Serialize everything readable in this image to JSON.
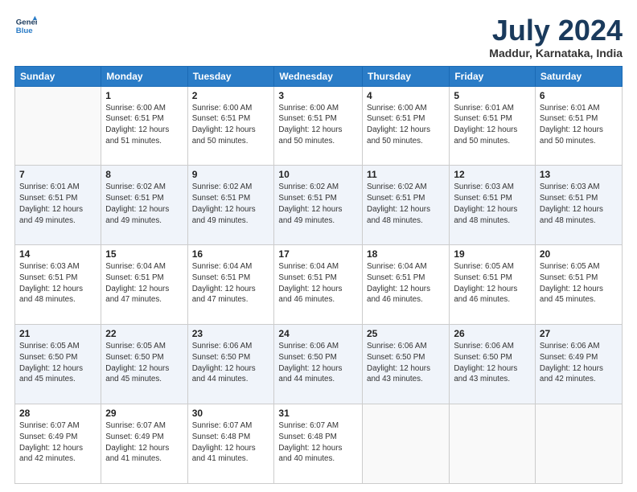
{
  "header": {
    "logo_line1": "General",
    "logo_line2": "Blue",
    "month": "July 2024",
    "location": "Maddur, Karnataka, India"
  },
  "days_of_week": [
    "Sunday",
    "Monday",
    "Tuesday",
    "Wednesday",
    "Thursday",
    "Friday",
    "Saturday"
  ],
  "weeks": [
    [
      {
        "day": "",
        "text": ""
      },
      {
        "day": "1",
        "text": "Sunrise: 6:00 AM\nSunset: 6:51 PM\nDaylight: 12 hours\nand 51 minutes."
      },
      {
        "day": "2",
        "text": "Sunrise: 6:00 AM\nSunset: 6:51 PM\nDaylight: 12 hours\nand 50 minutes."
      },
      {
        "day": "3",
        "text": "Sunrise: 6:00 AM\nSunset: 6:51 PM\nDaylight: 12 hours\nand 50 minutes."
      },
      {
        "day": "4",
        "text": "Sunrise: 6:00 AM\nSunset: 6:51 PM\nDaylight: 12 hours\nand 50 minutes."
      },
      {
        "day": "5",
        "text": "Sunrise: 6:01 AM\nSunset: 6:51 PM\nDaylight: 12 hours\nand 50 minutes."
      },
      {
        "day": "6",
        "text": "Sunrise: 6:01 AM\nSunset: 6:51 PM\nDaylight: 12 hours\nand 50 minutes."
      }
    ],
    [
      {
        "day": "7",
        "text": "Sunrise: 6:01 AM\nSunset: 6:51 PM\nDaylight: 12 hours\nand 49 minutes."
      },
      {
        "day": "8",
        "text": "Sunrise: 6:02 AM\nSunset: 6:51 PM\nDaylight: 12 hours\nand 49 minutes."
      },
      {
        "day": "9",
        "text": "Sunrise: 6:02 AM\nSunset: 6:51 PM\nDaylight: 12 hours\nand 49 minutes."
      },
      {
        "day": "10",
        "text": "Sunrise: 6:02 AM\nSunset: 6:51 PM\nDaylight: 12 hours\nand 49 minutes."
      },
      {
        "day": "11",
        "text": "Sunrise: 6:02 AM\nSunset: 6:51 PM\nDaylight: 12 hours\nand 48 minutes."
      },
      {
        "day": "12",
        "text": "Sunrise: 6:03 AM\nSunset: 6:51 PM\nDaylight: 12 hours\nand 48 minutes."
      },
      {
        "day": "13",
        "text": "Sunrise: 6:03 AM\nSunset: 6:51 PM\nDaylight: 12 hours\nand 48 minutes."
      }
    ],
    [
      {
        "day": "14",
        "text": "Sunrise: 6:03 AM\nSunset: 6:51 PM\nDaylight: 12 hours\nand 48 minutes."
      },
      {
        "day": "15",
        "text": "Sunrise: 6:04 AM\nSunset: 6:51 PM\nDaylight: 12 hours\nand 47 minutes."
      },
      {
        "day": "16",
        "text": "Sunrise: 6:04 AM\nSunset: 6:51 PM\nDaylight: 12 hours\nand 47 minutes."
      },
      {
        "day": "17",
        "text": "Sunrise: 6:04 AM\nSunset: 6:51 PM\nDaylight: 12 hours\nand 46 minutes."
      },
      {
        "day": "18",
        "text": "Sunrise: 6:04 AM\nSunset: 6:51 PM\nDaylight: 12 hours\nand 46 minutes."
      },
      {
        "day": "19",
        "text": "Sunrise: 6:05 AM\nSunset: 6:51 PM\nDaylight: 12 hours\nand 46 minutes."
      },
      {
        "day": "20",
        "text": "Sunrise: 6:05 AM\nSunset: 6:51 PM\nDaylight: 12 hours\nand 45 minutes."
      }
    ],
    [
      {
        "day": "21",
        "text": "Sunrise: 6:05 AM\nSunset: 6:50 PM\nDaylight: 12 hours\nand 45 minutes."
      },
      {
        "day": "22",
        "text": "Sunrise: 6:05 AM\nSunset: 6:50 PM\nDaylight: 12 hours\nand 45 minutes."
      },
      {
        "day": "23",
        "text": "Sunrise: 6:06 AM\nSunset: 6:50 PM\nDaylight: 12 hours\nand 44 minutes."
      },
      {
        "day": "24",
        "text": "Sunrise: 6:06 AM\nSunset: 6:50 PM\nDaylight: 12 hours\nand 44 minutes."
      },
      {
        "day": "25",
        "text": "Sunrise: 6:06 AM\nSunset: 6:50 PM\nDaylight: 12 hours\nand 43 minutes."
      },
      {
        "day": "26",
        "text": "Sunrise: 6:06 AM\nSunset: 6:50 PM\nDaylight: 12 hours\nand 43 minutes."
      },
      {
        "day": "27",
        "text": "Sunrise: 6:06 AM\nSunset: 6:49 PM\nDaylight: 12 hours\nand 42 minutes."
      }
    ],
    [
      {
        "day": "28",
        "text": "Sunrise: 6:07 AM\nSunset: 6:49 PM\nDaylight: 12 hours\nand 42 minutes."
      },
      {
        "day": "29",
        "text": "Sunrise: 6:07 AM\nSunset: 6:49 PM\nDaylight: 12 hours\nand 41 minutes."
      },
      {
        "day": "30",
        "text": "Sunrise: 6:07 AM\nSunset: 6:48 PM\nDaylight: 12 hours\nand 41 minutes."
      },
      {
        "day": "31",
        "text": "Sunrise: 6:07 AM\nSunset: 6:48 PM\nDaylight: 12 hours\nand 40 minutes."
      },
      {
        "day": "",
        "text": ""
      },
      {
        "day": "",
        "text": ""
      },
      {
        "day": "",
        "text": ""
      }
    ]
  ]
}
